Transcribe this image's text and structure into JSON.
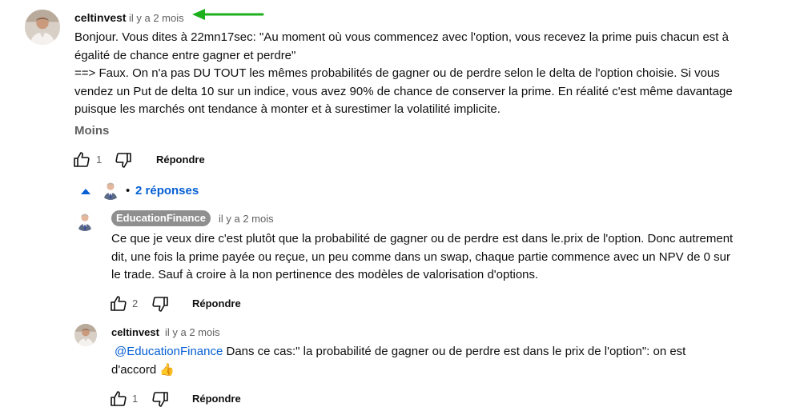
{
  "comment": {
    "author": "celtinvest",
    "time": "il y a 2 mois",
    "lines": [
      "Bonjour. Vous dites à 22mn17sec: \"Au moment où vous commencez avec l'option, vous recevez la prime puis chacun est à",
      "égalité de chance entre gagner et perdre\"",
      "==> Faux. On n'a pas DU TOUT les mêmes probabilités de gagner ou de perdre selon le delta de l'option choisie. Si vous",
      "vendez un Put de delta 10 sur un indice, vous avez 90% de chance de conserver la prime. En réalité c'est même davantage",
      "puisque les marchés ont tendance à monter et à surestimer la volatilité implicite."
    ],
    "more_label": "Moins",
    "likes": "1",
    "reply_label": "Répondre"
  },
  "replies_toggle": {
    "dot": "•",
    "label": "2 réponses"
  },
  "replies": [
    {
      "author": "EducationFinance",
      "time": "il y a 2 mois",
      "lines": [
        "Ce que je veux dire c'est plutôt que la probabilité de gagner ou de perdre est dans le.prix de l'option. Donc autrement",
        "dit, une fois la prime payée ou reçue, un peu comme dans un swap, chaque partie commence avec un NPV de 0 sur",
        "le trade. Sauf à croire à la non pertinence des modèles de valorisation d'options."
      ],
      "likes": "2",
      "reply_label": "Répondre"
    },
    {
      "author": "celtinvest",
      "time": "il y a 2 mois",
      "mention": "@EducationFinance",
      "line1_rest": " Dans ce cas:\" la probabilité de gagner ou de perdre est dans le prix de l'option\": on est",
      "line2": "d'accord 👍",
      "likes": "1",
      "reply_label": "Répondre"
    }
  ],
  "colors": {
    "annotation_arrow": "#1db01d",
    "link": "#065fd4",
    "chip_bg": "#8f8f8f"
  }
}
